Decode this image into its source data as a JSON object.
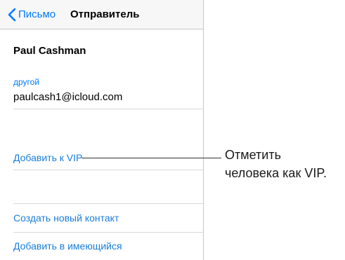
{
  "nav": {
    "back_label": "Письмо",
    "title": "Отправитель"
  },
  "contact": {
    "name": "Paul Cashman",
    "email_type": "другой",
    "email": "paulcash1@icloud.com"
  },
  "actions": {
    "add_vip": "Добавить к VIP",
    "create_contact": "Создать новый контакт",
    "add_existing": "Добавить в имеющийся"
  },
  "callout": {
    "line1": "Отметить",
    "line2": "человека как VIP."
  },
  "colors": {
    "accent": "#007aff",
    "link": "#1a7ddb",
    "nav_background": "#f7f7f8",
    "separator": "#d9d9de"
  },
  "icons": {
    "back": "chevron-left-icon"
  }
}
